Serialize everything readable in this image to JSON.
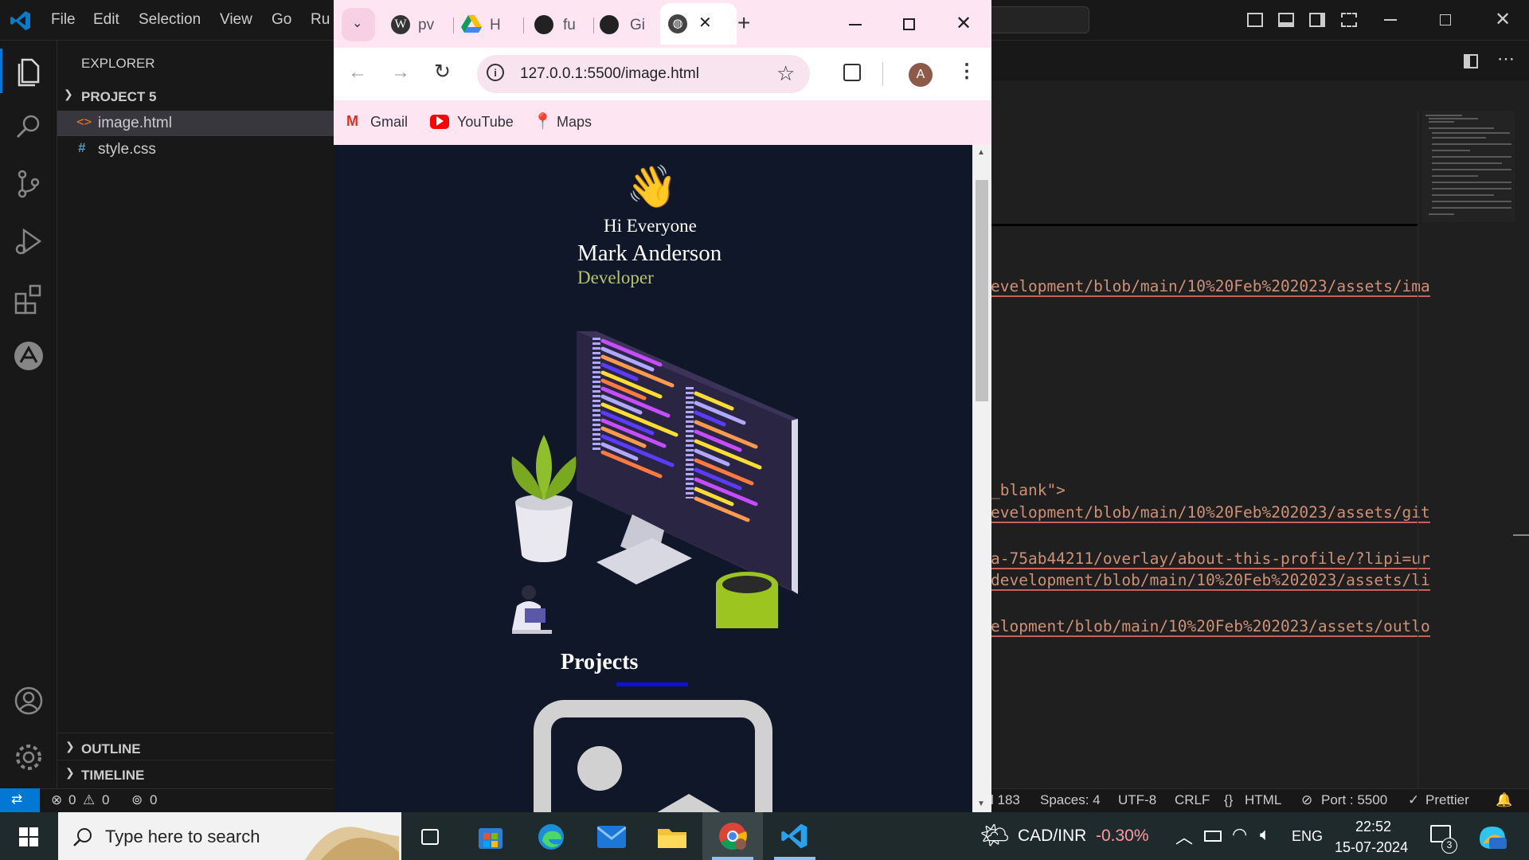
{
  "vscode": {
    "menu": [
      "File",
      "Edit",
      "Selection",
      "View",
      "Go",
      "Ru"
    ],
    "explorer_title": "EXPLORER",
    "project": "PROJECT 5",
    "files": [
      {
        "name": "image.html",
        "icon": "<>"
      },
      {
        "name": "style.css",
        "icon": "#"
      }
    ],
    "outline": "OUTLINE",
    "timeline": "TIMELINE",
    "code_lines": [
      "evelopment/blob/main/10%20Feb%202023/assets/ima",
      "_blank\">",
      "evelopment/blob/main/10%20Feb%202023/assets/git",
      "a-75ab44211/overlay/about-this-profile/?lipi=ur",
      "development/blob/main/10%20Feb%202023/assets/li",
      "elopment/blob/main/10%20Feb%202023/assets/outlo"
    ],
    "status": {
      "errors": "0",
      "warnings": "0",
      "ports": "0",
      "line": "l 183",
      "spaces": "Spaces: 4",
      "encoding": "UTF-8",
      "eol": "CRLF",
      "language": "HTML",
      "port": "Port : 5500",
      "prettier": "Prettier"
    }
  },
  "chrome": {
    "tabs": [
      "pv",
      "H",
      "fu",
      "Gi"
    ],
    "url": "127.0.0.1:5500/image.html",
    "avatar": "A",
    "bookmarks": [
      "Gmail",
      "YouTube",
      "Maps"
    ]
  },
  "page": {
    "greeting": "Hi Everyone",
    "name": "Mark Anderson",
    "role": "Developer",
    "projects_heading": "Projects",
    "colors": {
      "bg": "#101728",
      "role": "#b9c46e",
      "underline": "#1010d8"
    }
  },
  "taskbar": {
    "search_placeholder": "Type here to search",
    "ticker": "CAD/INR",
    "ticker_change": "-0.30%",
    "lang": "ENG",
    "time": "22:52",
    "date": "15-07-2024",
    "notifications": "3"
  }
}
